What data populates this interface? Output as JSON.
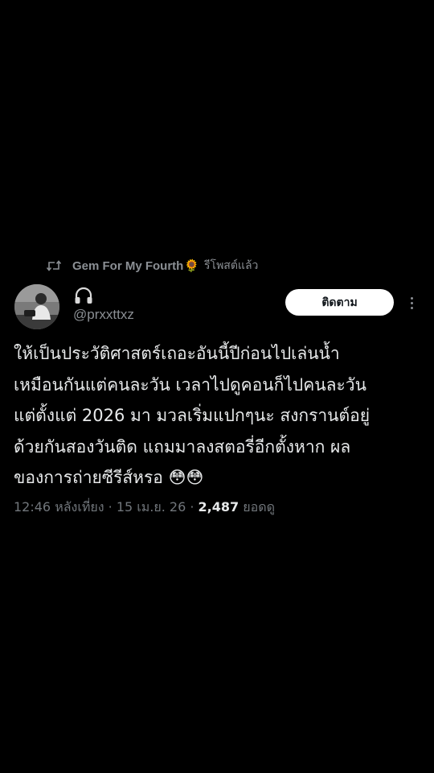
{
  "repost": {
    "icon": "repost-icon",
    "name": "Gem For My Fourth",
    "emoji": "🌻",
    "action": "รีโพสต์แล้ว"
  },
  "author": {
    "avatar": "avatar",
    "name_icon": "headphone-icon",
    "handle": "@prxxttxz"
  },
  "follow_button": {
    "label": "ติดตาม"
  },
  "more_icon": "more-icon",
  "tweet": {
    "text": "ให้เป็นประวัติศาสตร์เถอะอันนี้ปีก่อนไปเล่นน้ำ\nเหมือนกันแต่คนละวัน เวลาไปดูคอนก็ไปคนละวัน\nแต่ตั้งแต่ 2026 มา มวลเริ่มแปกๆนะ สงกรานต์อยู่\nด้วยกันสองวันติด แถมมาลงสตอรี่อีกตั้งหาก ผล\nของการถ่ายซีรีส์หรอ 😳😳"
  },
  "meta": {
    "time": "12:46 หลังเที่ยง",
    "separator": " · ",
    "date": "15 เม.ย. 26",
    "views_count": "2,487",
    "views_label": " ยอดดู"
  },
  "colors": {
    "background": "#000000",
    "text": "#e7e9ea",
    "muted": "#71767b",
    "button_bg": "#ffffff",
    "button_text": "#0f1419"
  }
}
